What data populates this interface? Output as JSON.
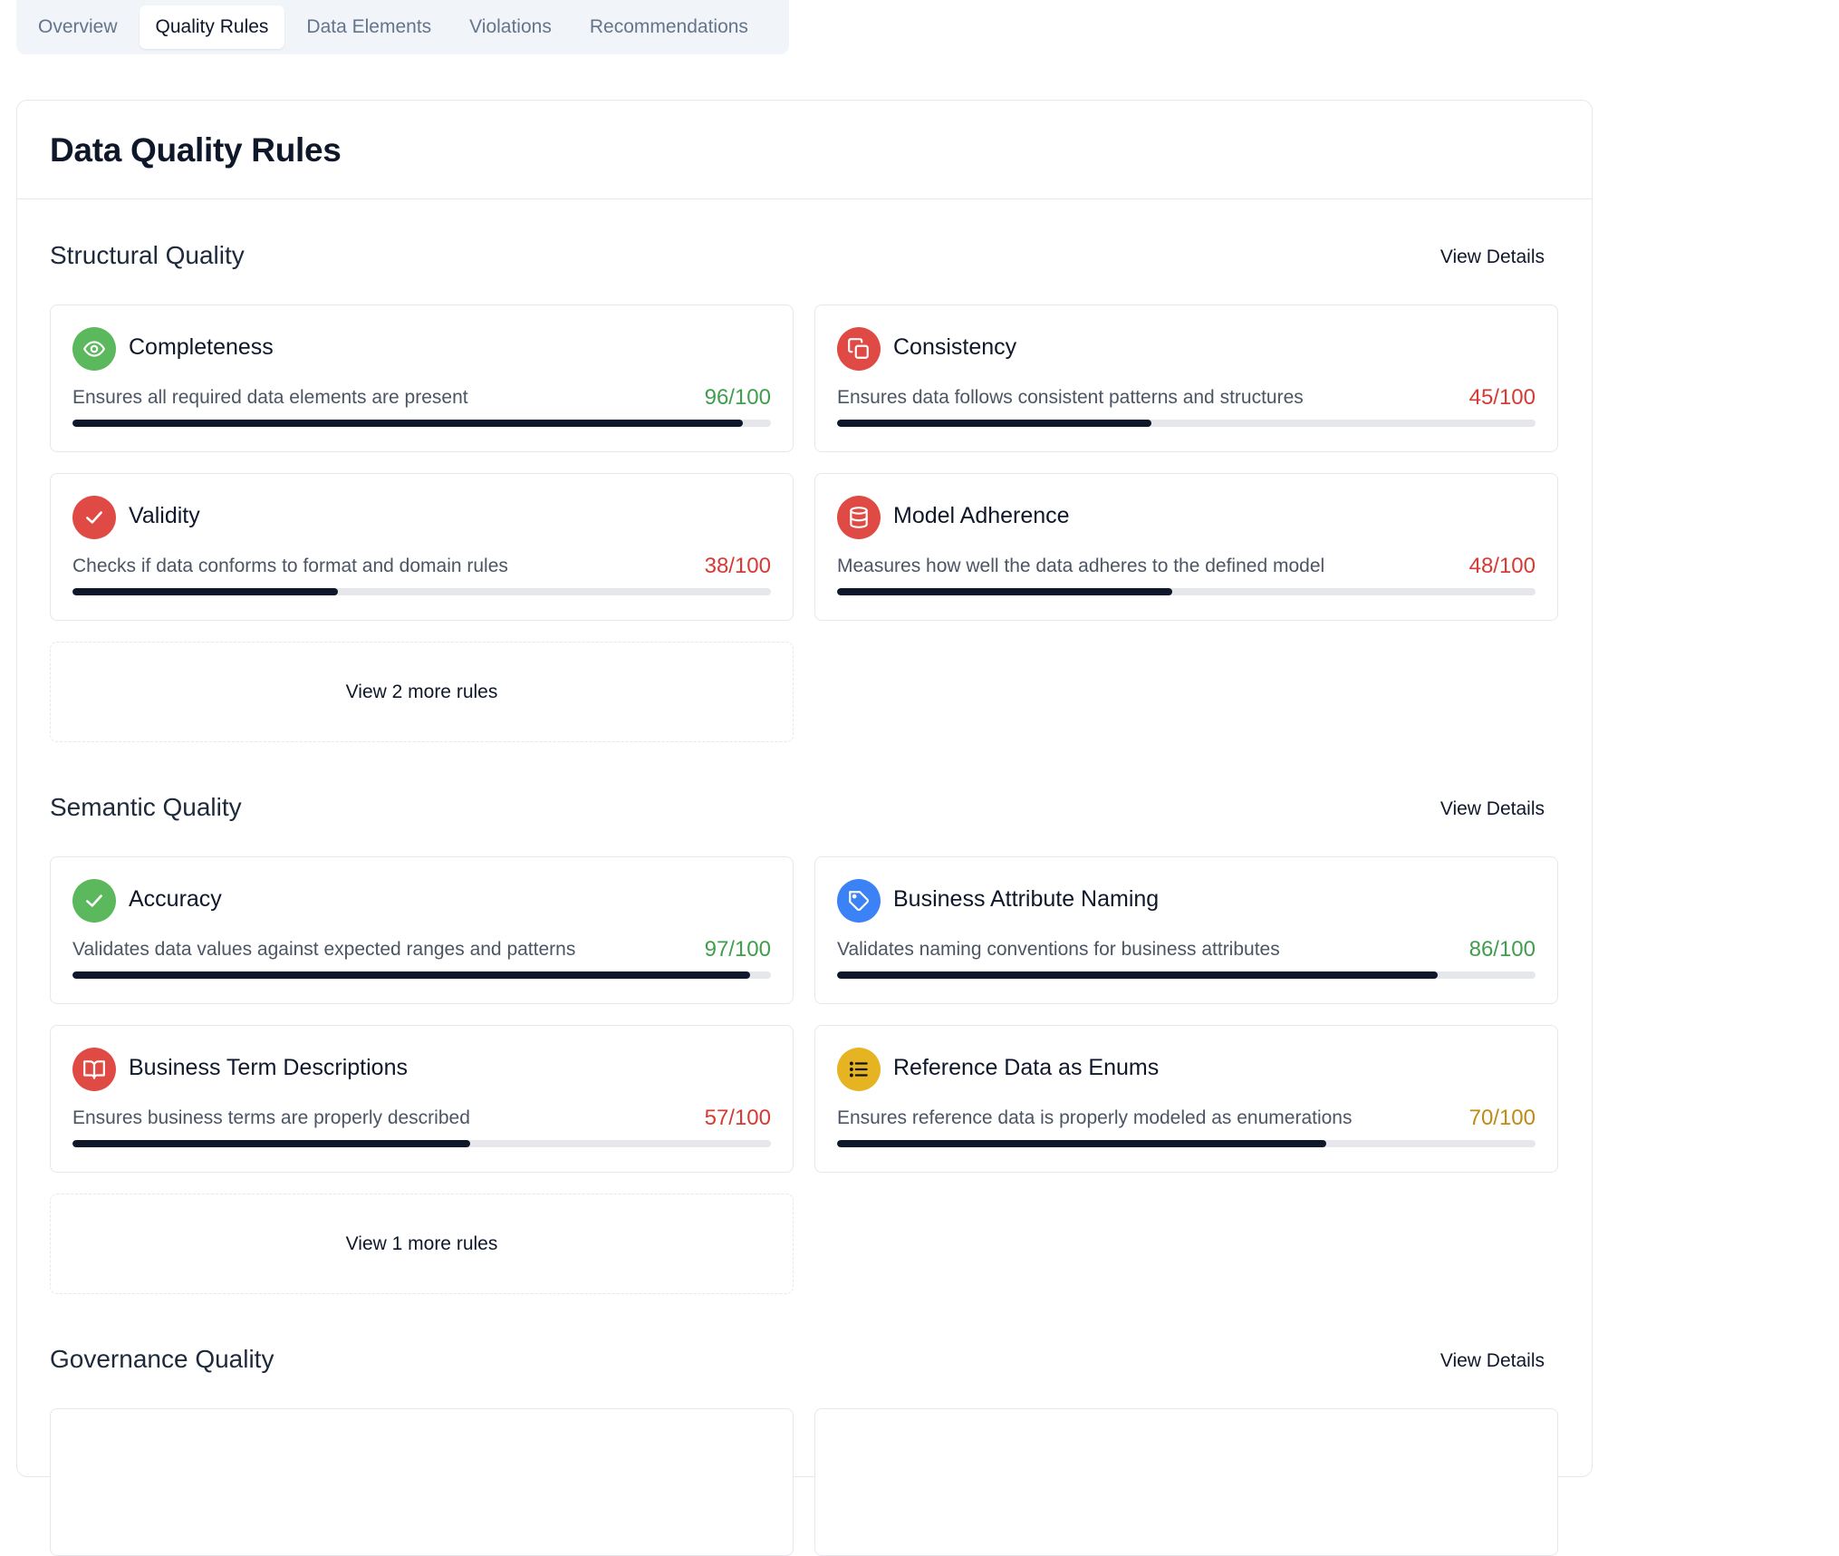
{
  "tabs": [
    {
      "label": "Overview"
    },
    {
      "label": "Quality Rules",
      "active": true
    },
    {
      "label": "Data Elements"
    },
    {
      "label": "Violations"
    },
    {
      "label": "Recommendations"
    }
  ],
  "page_title": "Data Quality Rules",
  "colors": {
    "good": "#3f9e4c",
    "bad": "#d63a34",
    "warn": "#c08a17",
    "icon_green": "#5cb85c",
    "icon_red": "#e04a44",
    "icon_blue": "#3b82f6",
    "icon_amber": "#e6b422"
  },
  "sections": [
    {
      "title": "Structural Quality",
      "view_details": "View Details",
      "rules": [
        {
          "name": "Completeness",
          "icon": "eye-icon",
          "description": "Ensures all required data elements are present",
          "score": "96/100",
          "fraction": 0.96,
          "status": "good"
        },
        {
          "name": "Consistency",
          "icon": "copy-icon",
          "description": "Ensures data follows consistent patterns and structures",
          "score": "45/100",
          "fraction": 0.45,
          "status": "bad"
        },
        {
          "name": "Validity",
          "icon": "check-icon",
          "description": "Checks if data conforms to format and domain rules",
          "score": "38/100",
          "fraction": 0.38,
          "status": "bad"
        },
        {
          "name": "Model Adherence",
          "icon": "database-icon",
          "description": "Measures how well the data adheres to the defined model",
          "score": "48/100",
          "fraction": 0.48,
          "status": "bad"
        }
      ],
      "more_label": "View 2 more rules"
    },
    {
      "title": "Semantic Quality",
      "view_details": "View Details",
      "rules": [
        {
          "name": "Accuracy",
          "icon": "check-icon",
          "description": "Validates data values against expected ranges and patterns",
          "score": "97/100",
          "fraction": 0.97,
          "status": "good"
        },
        {
          "name": "Business Attribute Naming",
          "icon": "tag-icon",
          "description": "Validates naming conventions for business attributes",
          "score": "86/100",
          "fraction": 0.86,
          "status": "good"
        },
        {
          "name": "Business Term Descriptions",
          "icon": "book-icon",
          "description": "Ensures business terms are properly described",
          "score": "57/100",
          "fraction": 0.57,
          "status": "bad"
        },
        {
          "name": "Reference Data as Enums",
          "icon": "list-icon",
          "description": "Ensures reference data is properly modeled as enumerations",
          "score": "70/100",
          "fraction": 0.7,
          "status": "warn"
        }
      ],
      "more_label": "View 1 more rules"
    },
    {
      "title": "Governance Quality",
      "view_details": "View Details"
    }
  ]
}
